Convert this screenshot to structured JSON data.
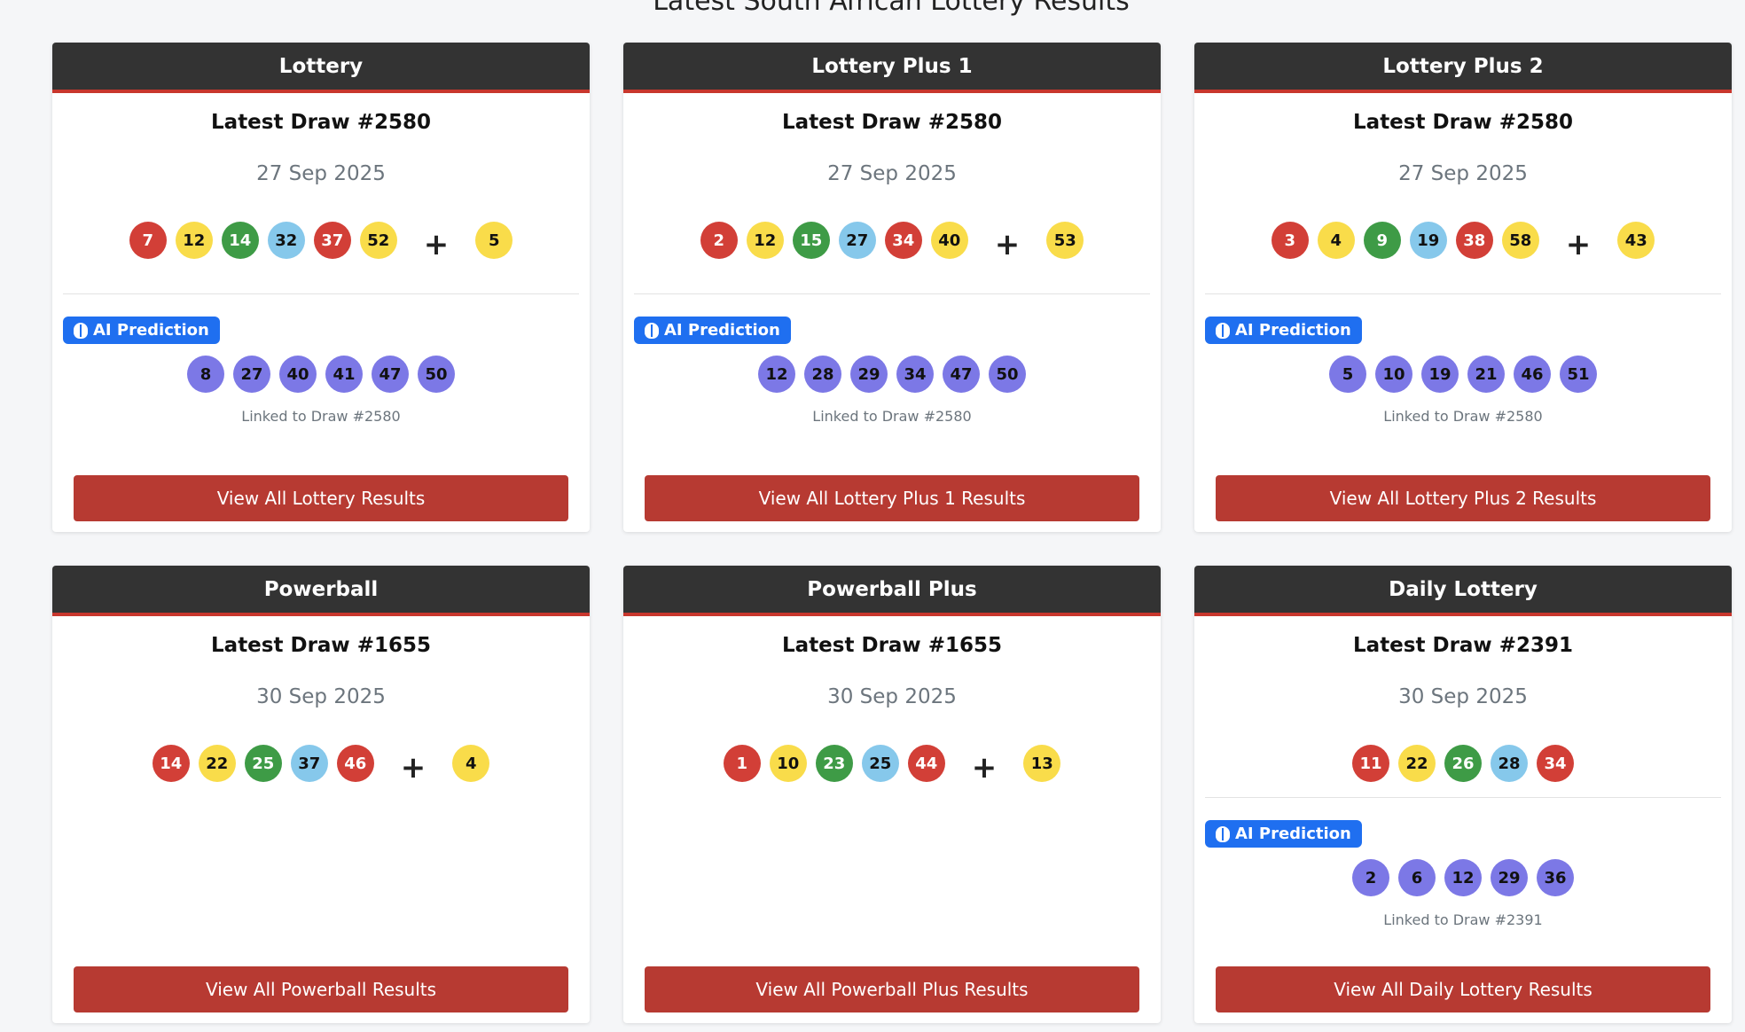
{
  "page": {
    "title": "Latest South African Lottery Results"
  },
  "cards": [
    {
      "name": "Lottery",
      "draw_title": "Latest Draw #2580",
      "date": "27 Sep 2025",
      "balls": [
        {
          "n": "7",
          "color": "red"
        },
        {
          "n": "12",
          "color": "yellow"
        },
        {
          "n": "14",
          "color": "green"
        },
        {
          "n": "32",
          "color": "blue"
        },
        {
          "n": "37",
          "color": "red"
        },
        {
          "n": "52",
          "color": "yellow"
        }
      ],
      "plus": "+",
      "bonus": {
        "n": "5",
        "color": "yellow"
      },
      "ai_label": "AI Prediction",
      "prediction": [
        "8",
        "27",
        "40",
        "41",
        "47",
        "50"
      ],
      "linked": "Linked to Draw #2580",
      "button": "View All Lottery Results"
    },
    {
      "name": "Lottery Plus 1",
      "draw_title": "Latest Draw #2580",
      "date": "27 Sep 2025",
      "balls": [
        {
          "n": "2",
          "color": "red"
        },
        {
          "n": "12",
          "color": "yellow"
        },
        {
          "n": "15",
          "color": "green"
        },
        {
          "n": "27",
          "color": "blue"
        },
        {
          "n": "34",
          "color": "red"
        },
        {
          "n": "40",
          "color": "yellow"
        }
      ],
      "plus": "+",
      "bonus": {
        "n": "53",
        "color": "yellow"
      },
      "ai_label": "AI Prediction",
      "prediction": [
        "12",
        "28",
        "29",
        "34",
        "47",
        "50"
      ],
      "linked": "Linked to Draw #2580",
      "button": "View All Lottery Plus 1 Results"
    },
    {
      "name": "Lottery Plus 2",
      "draw_title": "Latest Draw #2580",
      "date": "27 Sep 2025",
      "balls": [
        {
          "n": "3",
          "color": "red"
        },
        {
          "n": "4",
          "color": "yellow"
        },
        {
          "n": "9",
          "color": "green"
        },
        {
          "n": "19",
          "color": "blue"
        },
        {
          "n": "38",
          "color": "red"
        },
        {
          "n": "58",
          "color": "yellow"
        }
      ],
      "plus": "+",
      "bonus": {
        "n": "43",
        "color": "yellow"
      },
      "ai_label": "AI Prediction",
      "prediction": [
        "5",
        "10",
        "19",
        "21",
        "46",
        "51"
      ],
      "linked": "Linked to Draw #2580",
      "button": "View All Lottery Plus 2 Results"
    },
    {
      "name": "Powerball",
      "draw_title": "Latest Draw #1655",
      "date": "30 Sep 2025",
      "balls": [
        {
          "n": "14",
          "color": "red"
        },
        {
          "n": "22",
          "color": "yellow"
        },
        {
          "n": "25",
          "color": "green"
        },
        {
          "n": "37",
          "color": "blue"
        },
        {
          "n": "46",
          "color": "red"
        }
      ],
      "plus": "+",
      "bonus": {
        "n": "4",
        "color": "yellow"
      },
      "button": "View All Powerball Results"
    },
    {
      "name": "Powerball Plus",
      "draw_title": "Latest Draw #1655",
      "date": "30 Sep 2025",
      "balls": [
        {
          "n": "1",
          "color": "red"
        },
        {
          "n": "10",
          "color": "yellow"
        },
        {
          "n": "23",
          "color": "green"
        },
        {
          "n": "25",
          "color": "blue"
        },
        {
          "n": "44",
          "color": "red"
        }
      ],
      "plus": "+",
      "bonus": {
        "n": "13",
        "color": "yellow"
      },
      "button": "View All Powerball Plus Results"
    },
    {
      "name": "Daily Lottery",
      "draw_title": "Latest Draw #2391",
      "date": "30 Sep 2025",
      "balls": [
        {
          "n": "11",
          "color": "red"
        },
        {
          "n": "22",
          "color": "yellow"
        },
        {
          "n": "26",
          "color": "green"
        },
        {
          "n": "28",
          "color": "blue"
        },
        {
          "n": "34",
          "color": "red"
        }
      ],
      "ai_label": "AI Prediction",
      "prediction": [
        "2",
        "6",
        "12",
        "29",
        "36"
      ],
      "linked": "Linked to Draw #2391",
      "button": "View All Daily Lottery Results"
    }
  ],
  "colors": {
    "header_bg": "#333333",
    "header_accent": "#c8372d",
    "button_bg": "#b73a32",
    "ai_badge": "#1f6ff0",
    "ball_red": "#d23f37",
    "ball_yellow": "#f9dc4a",
    "ball_green": "#3e9b46",
    "ball_blue": "#86c8eb",
    "ball_purple": "#7c78e6"
  }
}
